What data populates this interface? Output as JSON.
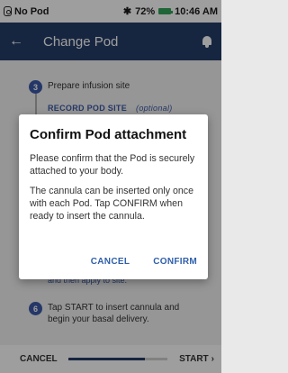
{
  "status_bar": {
    "carrier": "No Pod",
    "battery": "72%",
    "time": "10:46 AM"
  },
  "header": {
    "title": "Change Pod"
  },
  "steps": [
    {
      "number": "3",
      "text": "Prepare infusion site",
      "link": "RECORD POD SITE",
      "optional": "(optional)"
    },
    {
      "number": "6",
      "text": "Tap START to insert cannula and begin your basal delivery."
    }
  ],
  "partial_text": "and then apply to site.",
  "dialog": {
    "title": "Confirm Pod attachment",
    "paragraph1": "Please confirm that the Pod is securely attached to your body.",
    "paragraph2": "The cannula can be inserted only once with each Pod. Tap CONFIRM when ready to insert the cannula.",
    "cancel_label": "CANCEL",
    "confirm_label": "CONFIRM"
  },
  "bottom_bar": {
    "cancel_label": "CANCEL",
    "start_label": "START",
    "progress": 0.78
  },
  "colors": {
    "header": "#263e68",
    "accent": "#2f5faa",
    "battery": "#33a35a"
  }
}
